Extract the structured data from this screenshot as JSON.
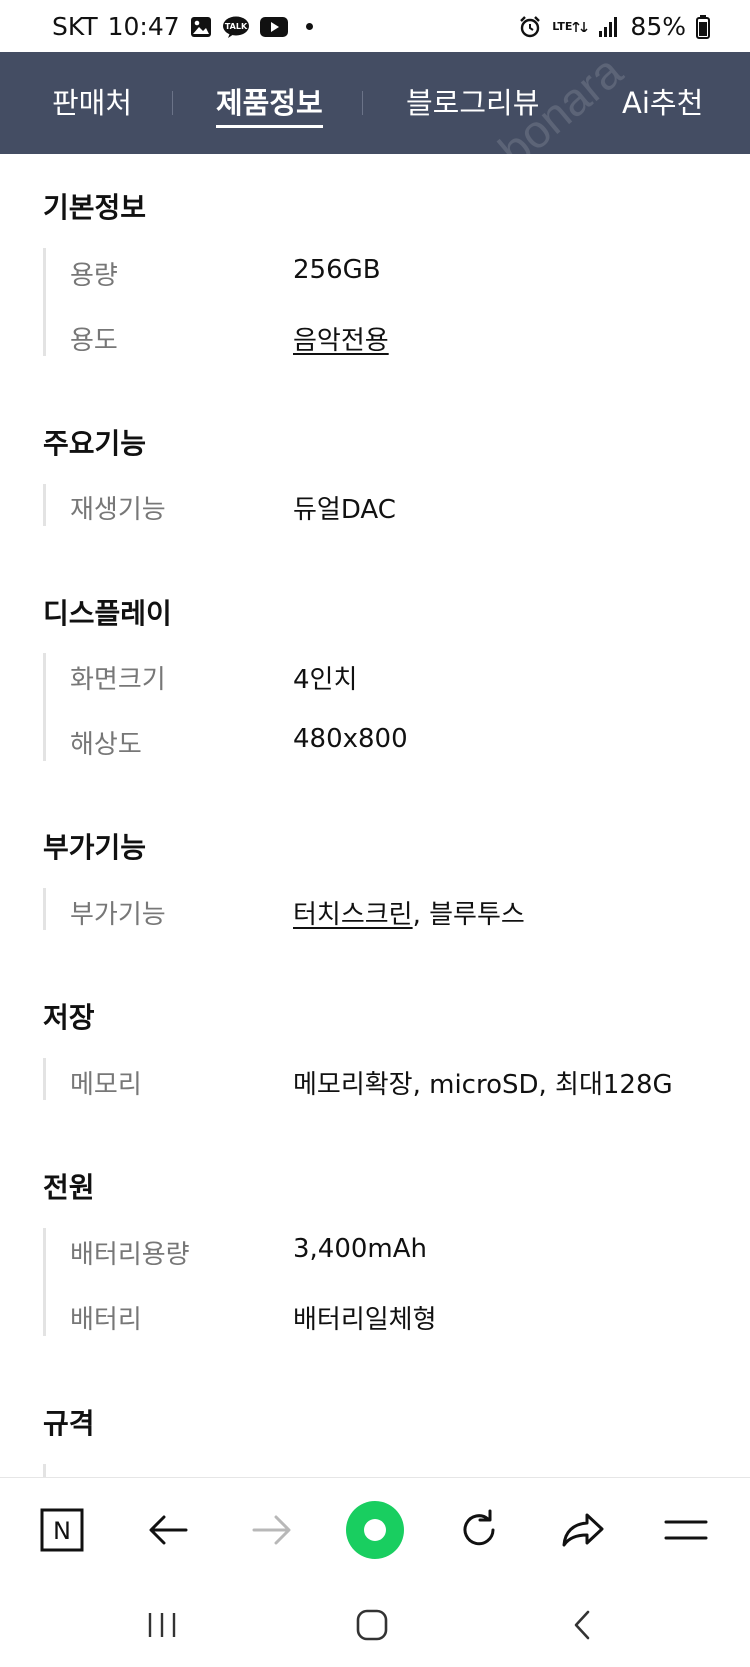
{
  "status_bar": {
    "carrier": "SKT",
    "time": "10:47",
    "network": "LTE",
    "battery": "85%",
    "icons": [
      "gallery-icon",
      "kakaotalk-icon",
      "youtube-icon",
      "alarm-icon",
      "signal-icon",
      "battery-icon"
    ]
  },
  "tabs": [
    {
      "label": "판매처",
      "active": false
    },
    {
      "label": "제품정보",
      "active": true
    },
    {
      "label": "블로그리뷰",
      "active": false
    },
    {
      "label": "Ai추천",
      "active": false
    }
  ],
  "sections": [
    {
      "title": "기본정보",
      "rows": [
        {
          "label": "용량",
          "value": "256GB"
        },
        {
          "label": "용도",
          "value": "음악전용"
        }
      ]
    },
    {
      "title": "주요기능",
      "rows": [
        {
          "label": "재생기능",
          "value": "듀얼DAC"
        }
      ]
    },
    {
      "title": "디스플레이",
      "rows": [
        {
          "label": "화면크기",
          "value": "4인치"
        },
        {
          "label": "해상도",
          "value": "480x800"
        }
      ]
    },
    {
      "title": "부가기능",
      "rows": [
        {
          "label": "부가기능",
          "value_link": "터치스크린",
          "value_rest": ", 블루투스"
        }
      ]
    },
    {
      "title": "저장",
      "rows": [
        {
          "label": "메모리",
          "value": "메모리확장, microSD, 최대128G"
        }
      ]
    },
    {
      "title": "전원",
      "rows": [
        {
          "label": "배터리용량",
          "value": "3,400mAh"
        },
        {
          "label": "배터리",
          "value": "배터리일체형"
        }
      ]
    },
    {
      "title": "규격",
      "rows": []
    }
  ],
  "toolbar": {
    "home_label": "N",
    "accent": "#19ce60",
    "icons": [
      "naver-home-icon",
      "back-arrow-icon",
      "forward-arrow-icon",
      "green-dot-icon",
      "refresh-icon",
      "share-icon",
      "menu-icon"
    ]
  },
  "colors": {
    "header_bg": "#444d63",
    "label": "#777777",
    "value": "#111111"
  }
}
